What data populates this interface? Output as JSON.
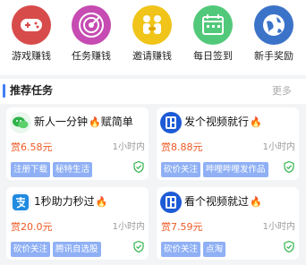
{
  "nav": {
    "items": [
      {
        "label": "游戏赚钱",
        "icon": "gamepad-icon",
        "color": "#d84b4b"
      },
      {
        "label": "任务赚钱",
        "icon": "target-icon",
        "color": "#c64bb2"
      },
      {
        "label": "邀请赚钱",
        "icon": "handshake-icon",
        "color": "#f0c419"
      },
      {
        "label": "每日签到",
        "icon": "calendar-icon",
        "color": "#52c97a"
      },
      {
        "label": "新手奖励",
        "icon": "globe-icon",
        "color": "#3b73c8"
      }
    ]
  },
  "section": {
    "title": "推荐任务",
    "more": "更多"
  },
  "tasks": [
    {
      "title": "新人一分钟",
      "title_suffix": "赋简单",
      "fire": "🔥",
      "reward": "赏6.58元",
      "time": "1小时内",
      "tags": [
        "注册下载",
        "秘特生活"
      ],
      "logo": "wechat-logo-icon"
    },
    {
      "title": "发个视频就行",
      "fire": "🔥",
      "reward": "赏8.88元",
      "time": "1小时内",
      "tags": [
        "砍价关注",
        "哔哩哔哩发作品"
      ],
      "logo": "miao-logo-icon"
    },
    {
      "title": "1秒助力秒过",
      "fire": "🔥",
      "reward": "赏20.0元",
      "time": "1小时内",
      "tags": [
        "砍价关注",
        "腾讯自选股"
      ],
      "logo": "alipay-logo-icon"
    },
    {
      "title": "看个视频就过",
      "fire": "🔥",
      "reward": "赏7.59元",
      "time": "1小时内",
      "tags": [
        "砍价关注",
        "点淘"
      ],
      "logo": "miao-logo-icon"
    }
  ],
  "colors": {
    "reward": "#ef5a24",
    "tag_bg": "#8fb0f5",
    "shield": "#2fb34a",
    "accent": "#3f7df5"
  }
}
